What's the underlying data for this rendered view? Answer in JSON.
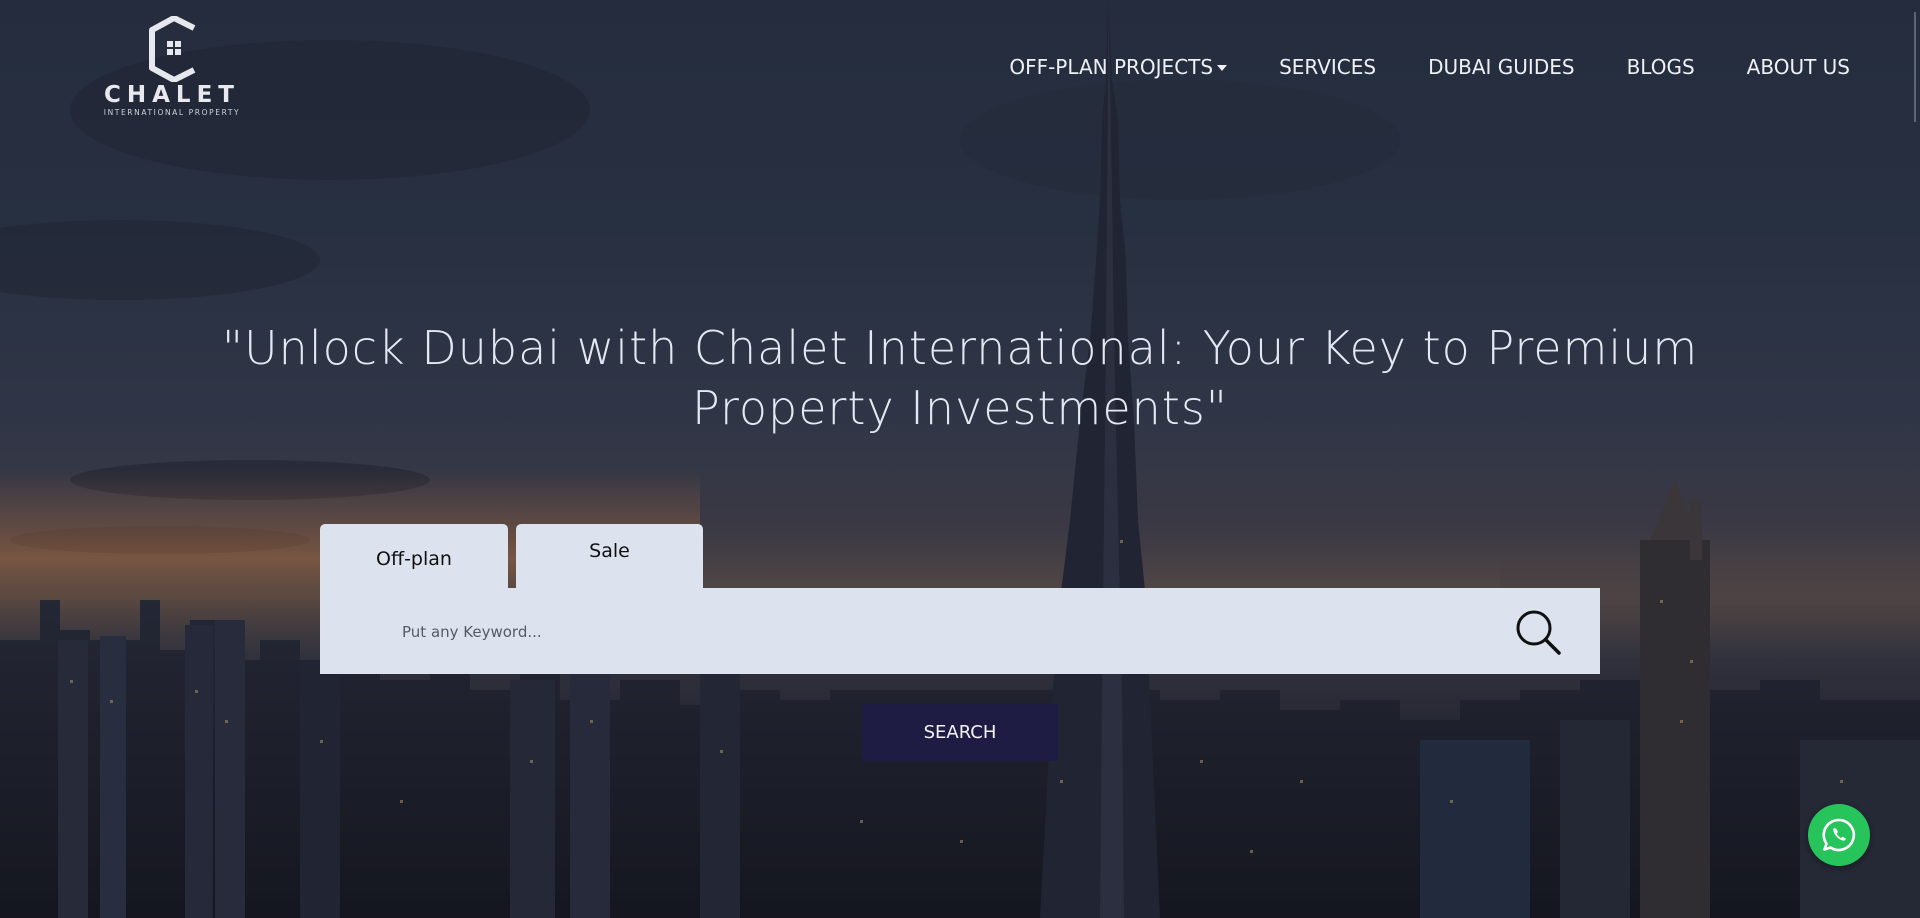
{
  "brand": {
    "name": "CHALET",
    "tagline": "INTERNATIONAL PROPERTY"
  },
  "nav": {
    "items": [
      {
        "label": "OFF-PLAN PROJECTS",
        "has_dropdown": true
      },
      {
        "label": "SERVICES"
      },
      {
        "label": "DUBAI GUIDES"
      },
      {
        "label": "BLOGS"
      },
      {
        "label": "ABOUT US"
      }
    ]
  },
  "hero": {
    "headline": "\"Unlock Dubai with Chalet International: Your Key to Premium Property Investments\""
  },
  "search": {
    "tabs": [
      {
        "label": "Off-plan"
      },
      {
        "label": "Sale"
      }
    ],
    "placeholder": "Put any Keyword...",
    "value": "",
    "button_label": "SEARCH"
  },
  "colors": {
    "search_button": "#1f1c44",
    "search_panel": "#dde3ee",
    "whatsapp": "#27c45c",
    "nav_text": "#eef0f5"
  },
  "icons": {
    "search": "magnifier",
    "chat": "whatsapp"
  }
}
